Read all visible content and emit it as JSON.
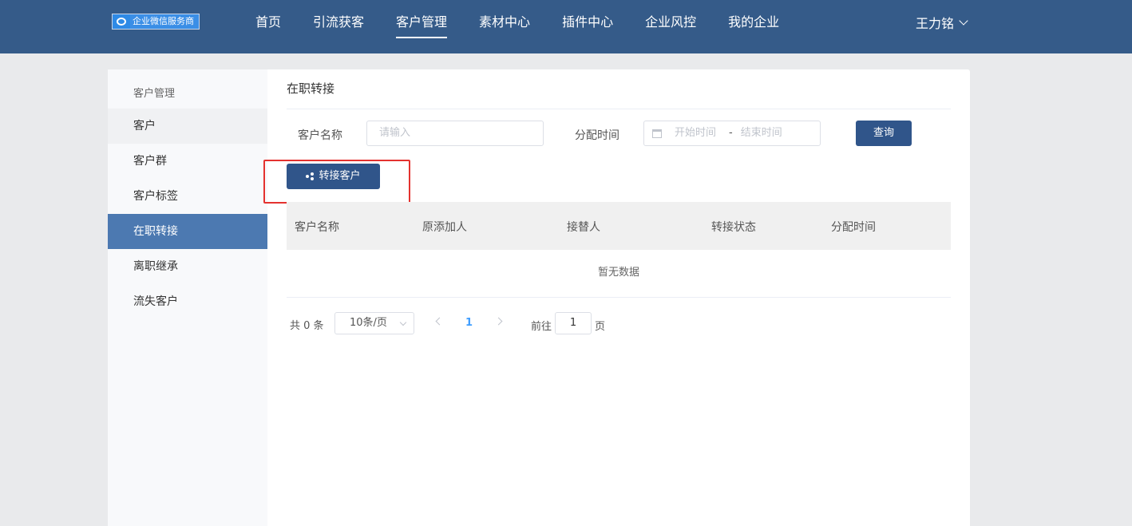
{
  "header": {
    "logo_text": "企业微信服务商",
    "nav": [
      "首页",
      "引流获客",
      "客户管理",
      "素材中心",
      "插件中心",
      "企业风控",
      "我的企业"
    ],
    "active_nav": "客户管理",
    "user_name": "王力铭"
  },
  "sidebar": {
    "heading": "客户管理",
    "items": [
      "客户",
      "客户群",
      "客户标签",
      "在职转接",
      "离职继承",
      "流失客户"
    ],
    "active_item": "在职转接"
  },
  "main": {
    "title": "在职转接",
    "filter": {
      "name_label": "客户名称",
      "name_placeholder": "请输入",
      "time_label": "分配时间",
      "start_placeholder": "开始时间",
      "range_separator": "-",
      "end_placeholder": "结束时间",
      "search_button": "查询"
    },
    "transfer_button": "转接客户",
    "table": {
      "columns": [
        "客户名称",
        "原添加人",
        "接替人",
        "转接状态",
        "分配时间"
      ],
      "empty_text": "暂无数据"
    },
    "pagination": {
      "total": "共 0 条",
      "page_size": "10条/页",
      "current_page": "1",
      "goto_label": "前往",
      "goto_value": "1",
      "page_suffix": "页"
    }
  },
  "colors": {
    "header_bg": "#355b89",
    "active_sidebar": "#4c79b1",
    "primary_button": "#30558a",
    "highlight_box": "#e4322f"
  }
}
